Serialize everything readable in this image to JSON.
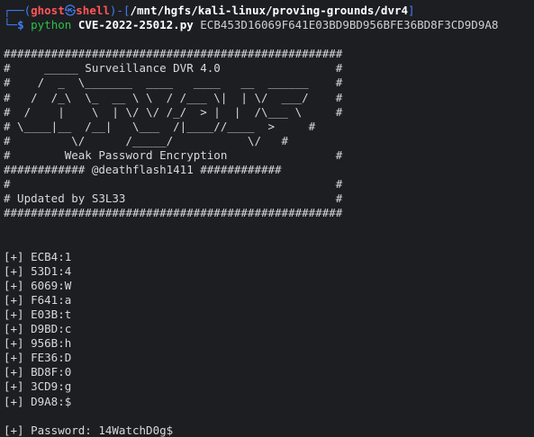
{
  "prompt": {
    "corner_top": "┌──(",
    "user": "ghost",
    "at_symbol": "㉿",
    "host": "shell",
    "mid": ")-[",
    "path": "/mnt/hgfs/kali-linux/proving-grounds/dvr4",
    "close": "]",
    "corner_bottom": "└─",
    "dollar": "$",
    "command": "python",
    "script": "CVE-2022-25012.py",
    "argument": "ECB453D16069F641E03BD9BD956BFE36BD8F3CD9D9A8"
  },
  "banner": [
    "##################################################",
    "#     _____ Surveillance DVR 4.0                 #",
    "#    /  _  \\_______  ____   ____   __  ______    #",
    "#   /  /_\\  \\_  __ \\ \\  / /___ \\|  | \\/  ___/    #",
    "#  /    |    \\  | \\/ \\/ /_/  > |  |  /\\___ \\     #",
    "# \\____|__  /__|   \\___  /|____//____  >     #",
    "#         \\/      /_____/           \\/   #",
    "#        Weak Password Encryption                #",
    "############ @deathflash1411 ############",
    "#                                                #",
    "# Updated by S3L33                               #",
    "##################################################"
  ],
  "results": [
    "[+] ECB4:1",
    "[+] 53D1:4",
    "[+] 6069:W",
    "[+] F641:a",
    "[+] E03B:t",
    "[+] D9BD:c",
    "[+] 956B:h",
    "[+] FE36:D",
    "[+] BD8F:0",
    "[+] 3CD9:g",
    "[+] D9A8:$"
  ],
  "password_line": "[+] Password: 14WatchD0g$",
  "colors": {
    "background": "#1d1e22",
    "prompt_frame": "#3f7ff5",
    "prompt_user": "#ff5656",
    "command": "#2ac04a",
    "text": "#d9d9d9"
  }
}
